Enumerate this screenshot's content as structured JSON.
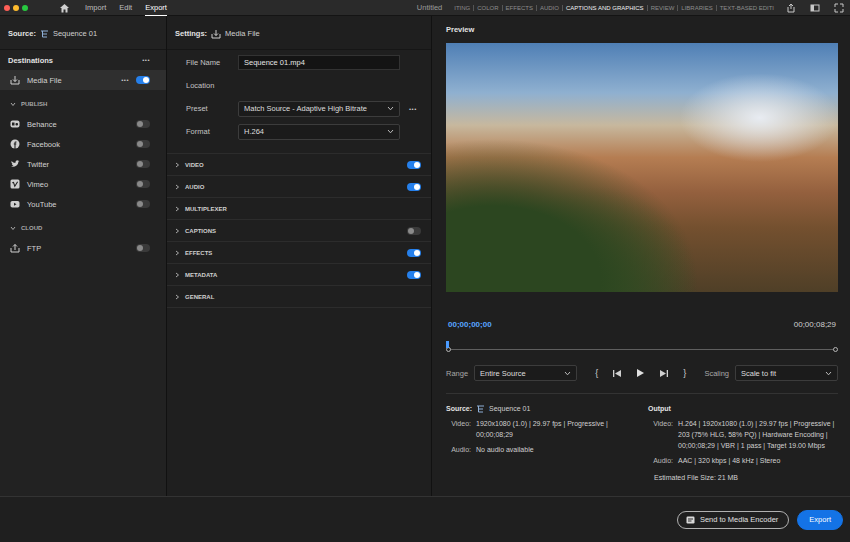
{
  "top_bar": {
    "nav": [
      {
        "label": "Import",
        "selected": false
      },
      {
        "label": "Edit",
        "selected": false
      },
      {
        "label": "Export",
        "selected": true
      }
    ],
    "title": "Untitled",
    "workspaces": [
      {
        "label": "ITING",
        "selected": false
      },
      {
        "label": "COLOR",
        "selected": false
      },
      {
        "label": "EFFECTS",
        "selected": false
      },
      {
        "label": "AUDIO",
        "selected": false
      },
      {
        "label": "CAPTIONS AND GRAPHICS",
        "selected": true
      },
      {
        "label": "REVIEW",
        "selected": false
      },
      {
        "label": "LIBRARIES",
        "selected": false
      },
      {
        "label": "TEXT-BASED EDITI",
        "selected": false
      }
    ]
  },
  "source": {
    "label": "Source:",
    "value": "Sequence 01"
  },
  "destinations": {
    "title": "Destinations",
    "menu": "•••",
    "items": [
      {
        "label": "Media File",
        "menu": "•••",
        "on": true,
        "selected": true
      }
    ],
    "groups": [
      {
        "title": "PUBLISH",
        "expanded": true,
        "items": [
          {
            "label": "Behance",
            "on": false,
            "selected": false
          },
          {
            "label": "Facebook",
            "on": false,
            "selected": false
          },
          {
            "label": "Twitter",
            "on": false,
            "selected": false
          },
          {
            "label": "Vimeo",
            "on": false,
            "selected": false
          },
          {
            "label": "YouTube",
            "on": false,
            "selected": false
          }
        ]
      },
      {
        "title": "CLOUD",
        "expanded": true,
        "items": [
          {
            "label": "FTP",
            "on": false,
            "selected": false
          }
        ]
      }
    ]
  },
  "settings": {
    "label": "Settings:",
    "value": "Media File",
    "fields": [
      {
        "label": "File Name",
        "kind": "text",
        "value": "Sequence 01.mp4"
      },
      {
        "label": "Location",
        "kind": "label"
      },
      {
        "label": "Preset",
        "kind": "dropdown",
        "value": "Match Source - Adaptive High Bitrate",
        "menu": "•••"
      },
      {
        "label": "Format",
        "kind": "dropdown",
        "value": "H.264"
      }
    ],
    "sections": [
      {
        "label": "VIDEO",
        "kind": "toggle",
        "expanded": false,
        "on": true
      },
      {
        "label": "AUDIO",
        "kind": "toggle",
        "expanded": false,
        "on": true
      },
      {
        "label": "MULTIPLEXER",
        "kind": "plain",
        "expanded": false
      },
      {
        "label": "CAPTIONS",
        "kind": "toggle",
        "expanded": false,
        "on": false
      },
      {
        "label": "EFFECTS",
        "kind": "toggle",
        "expanded": false,
        "on": true
      },
      {
        "label": "METADATA",
        "kind": "toggle",
        "expanded": false,
        "on": true
      },
      {
        "label": "GENERAL",
        "kind": "plain",
        "expanded": false
      }
    ]
  },
  "preview": {
    "title": "Preview",
    "time_current": "00;00;00;00",
    "time_end": "00;00;08;29",
    "playhead": {
      "level": 0
    },
    "range": {
      "label": "Range",
      "value": "Entire Source"
    },
    "mark_in": "{",
    "mark_out": "}",
    "scaling": {
      "label": "Scaling",
      "value": "Scale to fit"
    }
  },
  "source_info": {
    "title": "Source:",
    "name": "Sequence 01",
    "rows": [
      {
        "label": "Video:",
        "value": "1920x1080 (1.0) | 29.97 fps | Progressive | 00;00;08;29"
      },
      {
        "label": "Audio:",
        "value": "No audio available"
      }
    ]
  },
  "output_info": {
    "title": "Output",
    "rows": [
      {
        "label": "Video:",
        "value": "H.264 | 1920x1080 (1.0) | 29.97 fps | Progressive | 203 (75% HLG, 58% PQ) | Hardware Encoding | 00;00;08;29 | VBR | 1 pass | Target 19.00 Mbps"
      },
      {
        "label": "Audio:",
        "value": "AAC | 320 kbps | 48 kHz | Stereo"
      }
    ],
    "file_size": "Estimated File Size: 21 MB"
  },
  "buttons": [
    {
      "label": "Send to Media Encoder",
      "kind": "secondary"
    },
    {
      "label": "Export",
      "kind": "primary"
    }
  ]
}
